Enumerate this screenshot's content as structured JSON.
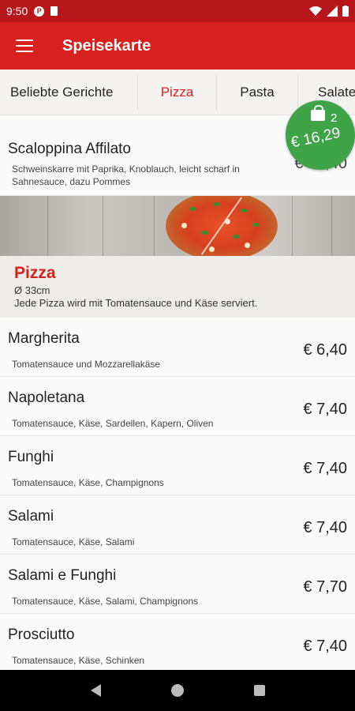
{
  "statusbar": {
    "time": "9:50"
  },
  "appbar": {
    "title": "Speisekarte"
  },
  "tabs": [
    "Beliebte Gerichte",
    "Pizza",
    "Pasta",
    "Salate"
  ],
  "active_tab": "Pizza",
  "featured": {
    "name": "Scaloppina Affilato",
    "desc": "Schweinskarre mit Paprika, Knoblauch, leicht scharf in Sahnesauce, dazu Pommes",
    "price": "€ 12,40"
  },
  "section": {
    "title": "Pizza",
    "size": "Ø 33cm",
    "note": "Jede Pizza wird mit Tomatensauce und Käse serviert."
  },
  "items": [
    {
      "name": "Margherita",
      "desc": "Tomatensauce und Mozzarellakäse",
      "price": "€ 6,40"
    },
    {
      "name": "Napoletana",
      "desc": "Tomatensauce, Käse, Sardellen, Kapern, Oliven",
      "price": "€ 7,40"
    },
    {
      "name": "Funghi",
      "desc": "Tomatensauce, Käse, Champignons",
      "price": "€ 7,40"
    },
    {
      "name": "Salami",
      "desc": "Tomatensauce, Käse, Salami",
      "price": "€ 7,40"
    },
    {
      "name": "Salami e Funghi",
      "desc": "Tomatensauce, Käse, Salami, Champignons",
      "price": "€ 7,70"
    },
    {
      "name": "Prosciutto",
      "desc": "Tomatensauce, Käse, Schinken",
      "price": "€ 7,40"
    }
  ],
  "cart": {
    "count": "2",
    "total": "€ 16,29"
  },
  "colors": {
    "brand_red": "#d8211f",
    "cart_green": "#3fa447"
  }
}
